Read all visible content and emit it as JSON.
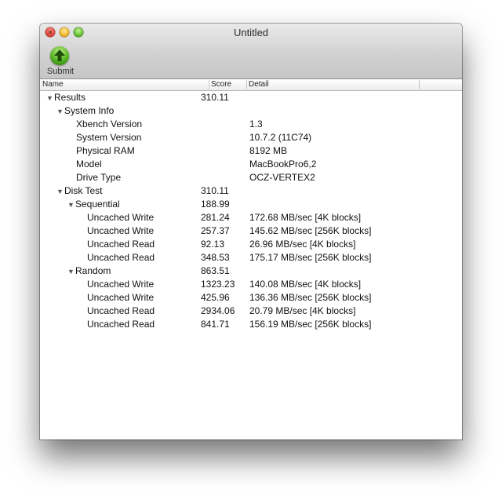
{
  "window": {
    "title": "Untitled"
  },
  "toolbar": {
    "submit_label": "Submit"
  },
  "table": {
    "columns": [
      "Name",
      "Score",
      "Detail"
    ],
    "rows": [
      {
        "name": "Results",
        "score": "310.11",
        "detail": "",
        "expander": "▼"
      },
      {
        "name": "System Info",
        "score": "",
        "detail": "",
        "expander": "▼"
      },
      {
        "name": "Xbench Version",
        "score": "",
        "detail": "1.3",
        "expander": ""
      },
      {
        "name": "System Version",
        "score": "",
        "detail": "10.7.2 (11C74)",
        "expander": ""
      },
      {
        "name": "Physical RAM",
        "score": "",
        "detail": "8192 MB",
        "expander": ""
      },
      {
        "name": "Model",
        "score": "",
        "detail": "MacBookPro6,2",
        "expander": ""
      },
      {
        "name": "Drive Type",
        "score": "",
        "detail": "OCZ-VERTEX2",
        "expander": ""
      },
      {
        "name": "Disk Test",
        "score": "310.11",
        "detail": "",
        "expander": "▼"
      },
      {
        "name": "Sequential",
        "score": "188.99",
        "detail": "",
        "expander": "▼"
      },
      {
        "name": "Uncached Write",
        "score": "281.24",
        "detail": "172.68 MB/sec [4K blocks]",
        "expander": ""
      },
      {
        "name": "Uncached Write",
        "score": "257.37",
        "detail": "145.62 MB/sec [256K blocks]",
        "expander": ""
      },
      {
        "name": "Uncached Read",
        "score": "92.13",
        "detail": "26.96 MB/sec [4K blocks]",
        "expander": ""
      },
      {
        "name": "Uncached Read",
        "score": "348.53",
        "detail": "175.17 MB/sec [256K blocks]",
        "expander": ""
      },
      {
        "name": "Random",
        "score": "863.51",
        "detail": "",
        "expander": "▼"
      },
      {
        "name": "Uncached Write",
        "score": "1323.23",
        "detail": "140.08 MB/sec [4K blocks]",
        "expander": ""
      },
      {
        "name": "Uncached Write",
        "score": "425.96",
        "detail": "136.36 MB/sec [256K blocks]",
        "expander": ""
      },
      {
        "name": "Uncached Read",
        "score": "2934.06",
        "detail": "20.79 MB/sec [4K blocks]",
        "expander": ""
      },
      {
        "name": "Uncached Read",
        "score": "841.71",
        "detail": "156.19 MB/sec [256K blocks]",
        "expander": ""
      }
    ]
  },
  "icons": {
    "submit": "upload-arrow-icon",
    "expander": "disclosure-triangle-icon"
  },
  "colors": {
    "submit_green": "#4fae1c",
    "close": "#e2463b",
    "minimize": "#f0b52c",
    "zoom": "#5fbf2c"
  }
}
